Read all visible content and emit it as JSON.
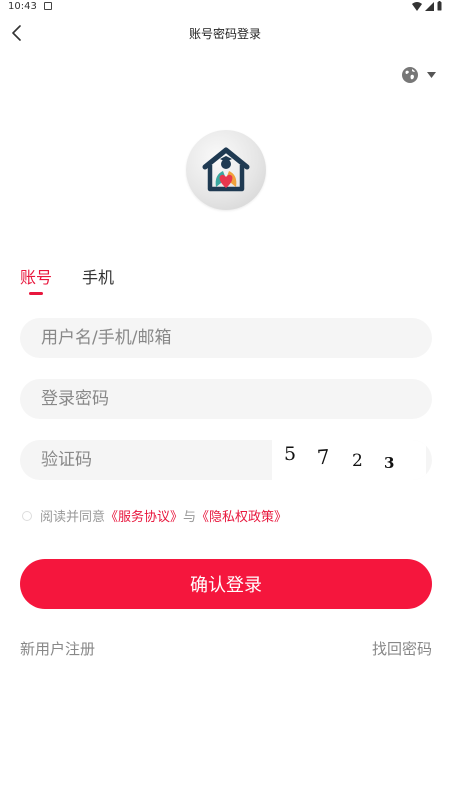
{
  "status_bar": {
    "time": "10:43"
  },
  "nav": {
    "title": "账号密码登录"
  },
  "tabs": [
    {
      "label": "账号",
      "active": true
    },
    {
      "label": "手机",
      "active": false
    }
  ],
  "form": {
    "username_placeholder": "用户名/手机/邮箱",
    "password_placeholder": "登录密码",
    "captcha_placeholder": "验证码",
    "captcha_digits": [
      "5",
      "7",
      "2",
      "3"
    ]
  },
  "agreement": {
    "prefix": "阅读并同意",
    "service_link": "《服务协议》",
    "conjunction": "与",
    "privacy_link": "《隐私权政策》",
    "checked": false
  },
  "login_button": "确认登录",
  "links": {
    "register": "新用户注册",
    "forgot": "找回密码"
  },
  "colors": {
    "accent": "#e8173d",
    "button": "#f5163d",
    "input_bg": "#f5f5f5"
  },
  "icons": {
    "back": "chevron-left-icon",
    "language": "globe-icon",
    "dropdown": "caret-down-icon"
  }
}
